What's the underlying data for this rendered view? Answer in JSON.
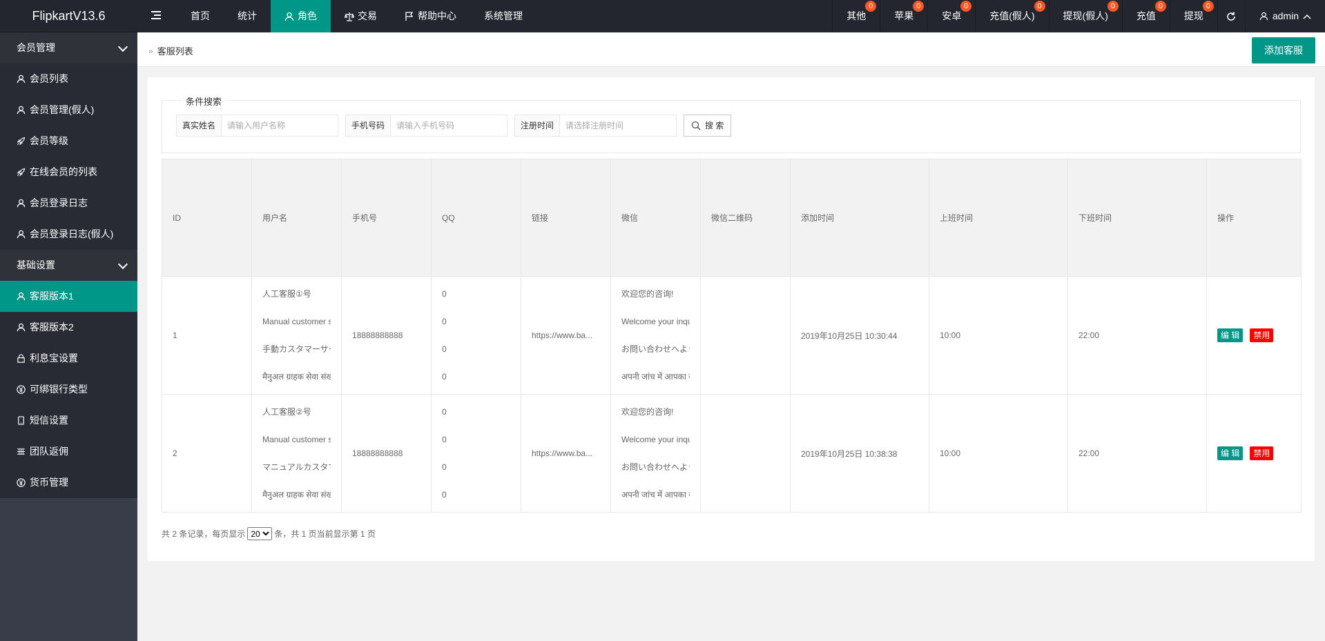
{
  "app": {
    "title": "FlipkartV13.6"
  },
  "topnav": {
    "items": [
      {
        "label": "首页",
        "icon": "none"
      },
      {
        "label": "统计",
        "icon": "none"
      },
      {
        "label": "角色",
        "icon": "user-icon",
        "active": true
      },
      {
        "label": "交易",
        "icon": "scale-icon"
      },
      {
        "label": "帮助中心",
        "icon": "flag-icon"
      },
      {
        "label": "系统管理",
        "icon": "none"
      }
    ]
  },
  "rightnav": {
    "items": [
      {
        "label": "其他",
        "badge": "0"
      },
      {
        "label": "苹果",
        "badge": "0"
      },
      {
        "label": "安卓",
        "badge": "0"
      },
      {
        "label": "充值(假人)",
        "badge": "0"
      },
      {
        "label": "提现(假人)",
        "badge": "0"
      },
      {
        "label": "充值",
        "badge": "0"
      },
      {
        "label": "提现",
        "badge": "0"
      }
    ],
    "user": "admin"
  },
  "sidebar": {
    "groups": [
      {
        "title": "会员管理",
        "items": [
          {
            "label": "会员列表",
            "icon": "user-icon"
          },
          {
            "label": "会员管理(假人)",
            "icon": "user-icon"
          },
          {
            "label": "会员等级",
            "icon": "rocket-icon"
          },
          {
            "label": "在线会员的列表",
            "icon": "rocket-icon"
          },
          {
            "label": "会员登录日志",
            "icon": "user-icon"
          },
          {
            "label": "会员登录日志(假人)",
            "icon": "user-icon"
          }
        ]
      },
      {
        "title": "基础设置",
        "items": [
          {
            "label": "客服版本1",
            "icon": "user-icon",
            "active": true
          },
          {
            "label": "客服版本2",
            "icon": "user-icon"
          },
          {
            "label": "利息宝设置",
            "icon": "lock-icon"
          },
          {
            "label": "可绑银行类型",
            "icon": "yen-icon"
          },
          {
            "label": "短信设置",
            "icon": "phone-icon"
          },
          {
            "label": "团队返佣",
            "icon": "grid-icon"
          },
          {
            "label": "货币管理",
            "icon": "yen-icon"
          }
        ]
      }
    ]
  },
  "breadcrumb": {
    "label": "客服列表"
  },
  "add_button": "添加客服",
  "search": {
    "legend": "条件搜索",
    "fields": [
      {
        "label": "真实姓名",
        "placeholder": "请输入用户名称"
      },
      {
        "label": "手机号码",
        "placeholder": "请输入手机号码"
      },
      {
        "label": "注册时间",
        "placeholder": "请选择注册时间"
      }
    ],
    "button": "搜 索"
  },
  "table": {
    "headers": [
      "ID",
      "用户名",
      "手机号",
      "QQ",
      "链接",
      "微信",
      "微信二维码",
      "添加时间",
      "上班时间",
      "下班时间",
      "操作"
    ],
    "rows": [
      {
        "id": "1",
        "usernames": [
          "人工客服①号",
          "Manual customer se",
          "手動カスタマーサービ",
          "मैनुअल ग्राहक सेवा संख्य"
        ],
        "phone": "18888888888",
        "qq": [
          "0",
          "0",
          "0",
          "0"
        ],
        "link": "https://www.ba...",
        "wechat": [
          "欢迎您的咨询!",
          "Welcome your inqui",
          "お問い合わせへようこ",
          "अपनी जांच में आपका स्व"
        ],
        "qrcode": "",
        "added": "2019年10月25日 10:30:44",
        "start": "10:00",
        "end": "22:00",
        "edit": "编 辑",
        "disable": "禁用"
      },
      {
        "id": "2",
        "usernames": [
          "人工客服②号",
          "Manual customer se",
          "マニュアルカスタマー",
          "मैनुअल ग्राहक सेवा संख्य"
        ],
        "phone": "18888888888",
        "qq": [
          "0",
          "0",
          "0",
          "0"
        ],
        "link": "https://www.ba...",
        "wechat": [
          "欢迎您的咨询!",
          "Welcome your inqui",
          "お問い合わせへようこ",
          "अपनी जांच में आपका स्व"
        ],
        "qrcode": "",
        "added": "2019年10月25日 10:38:38",
        "start": "10:00",
        "end": "22:00",
        "edit": "编 辑",
        "disable": "禁用"
      }
    ]
  },
  "pager": {
    "prefix": "共 2 条记录，每页显示",
    "page_size": "20",
    "suffix": "条，共 1 页当前显示第 1 页"
  }
}
